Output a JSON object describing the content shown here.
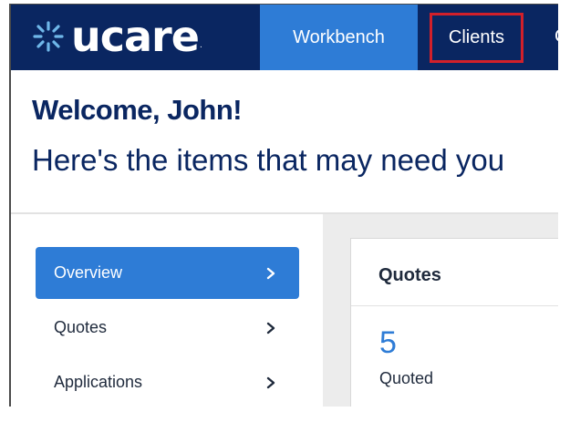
{
  "header": {
    "logo_text": "ucare",
    "logo_mark": "ucare-starburst-logo",
    "nav": {
      "workbench": "Workbench",
      "clients": "Clients",
      "more_partial": "C"
    }
  },
  "welcome": {
    "title": "Welcome, John!",
    "subtitle": "Here's the items that may need you"
  },
  "sidebar": {
    "items": [
      {
        "label": "Overview",
        "active": true
      },
      {
        "label": "Quotes",
        "active": false
      },
      {
        "label": "Applications",
        "active": false
      }
    ]
  },
  "quotes_card": {
    "title": "Quotes",
    "count": "5",
    "count_label": "Quoted"
  },
  "colors": {
    "header_bg": "#0a2661",
    "accent": "#2e7cd6",
    "highlight_border": "#d2202a",
    "panel_bg": "#ececec"
  },
  "icons": [
    "ucare-logo-icon",
    "chevron-right-icon"
  ]
}
